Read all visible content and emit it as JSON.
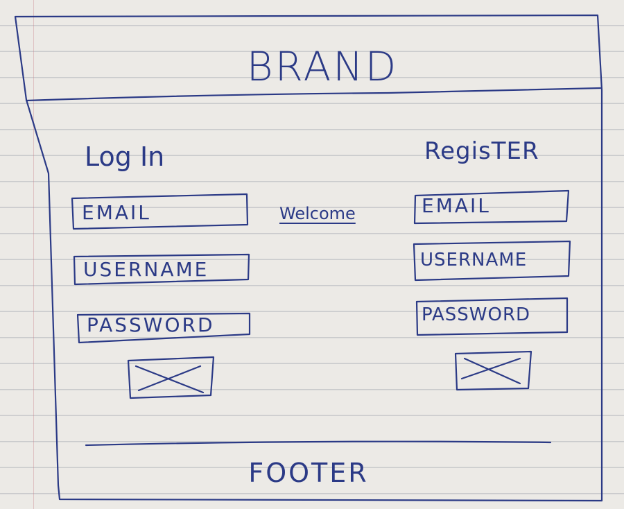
{
  "header": {
    "brand": "BRAND"
  },
  "login": {
    "title": "Log In",
    "email": "EMAIL",
    "username": "USERNAME",
    "password": "PASSWORD"
  },
  "center": {
    "welcome": "Welcome"
  },
  "register": {
    "title": "RegisTER",
    "email": "EMAIL",
    "username": "USERNAME",
    "password": "PASSWORD"
  },
  "footer": {
    "text": "FOOTER"
  },
  "ink_color": "#2b3a86",
  "paper_color": "#eceae6"
}
